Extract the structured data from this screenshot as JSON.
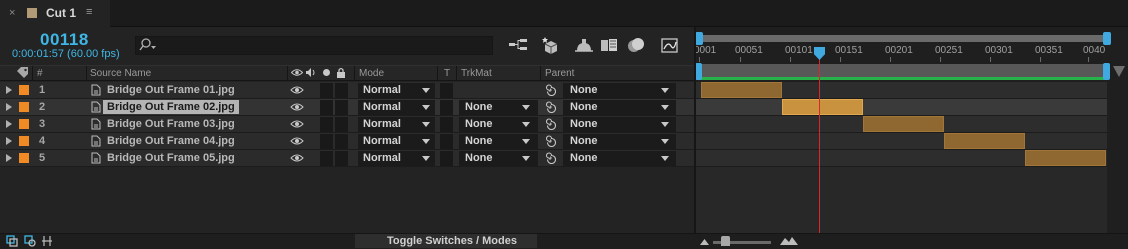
{
  "tab": {
    "close": "×",
    "title": "Cut 1",
    "menu": "≡",
    "swatch_color": "#b29a76"
  },
  "header": {
    "timecode": "00118",
    "timecode_detail": "0:00:01:57 (60.00 fps)",
    "search_placeholder": ""
  },
  "icons": {
    "search": "search-icon",
    "comp_flowchart": "flowchart-icon",
    "draft_3d": "draft-3d-icon",
    "hide_shy": "shy-layers-icon",
    "frame_blending": "frame-blending-icon",
    "motion_blur": "motion-blur-icon",
    "graph_editor": "graph-editor-icon"
  },
  "ruler": {
    "labels": [
      "0001",
      "00051",
      "00101",
      "00151",
      "00201",
      "00251",
      "00301",
      "00351",
      "0040"
    ],
    "current_frame": 118,
    "start": 1,
    "end": 401
  },
  "columns": {
    "hash": "#",
    "source_name": "Source Name",
    "mode": "Mode",
    "t": "T",
    "trkmat": "TrkMat",
    "parent": "Parent"
  },
  "layers": [
    {
      "num": "1",
      "name": "Bridge Out Frame 01.jpg",
      "mode": "Normal",
      "trkmat": "",
      "parent": "None",
      "in": 1,
      "out": 81,
      "selected": false
    },
    {
      "num": "2",
      "name": "Bridge Out Frame 02.jpg",
      "mode": "Normal",
      "trkmat": "None",
      "parent": "None",
      "in": 81,
      "out": 161,
      "selected": true
    },
    {
      "num": "3",
      "name": "Bridge Out Frame 03.jpg",
      "mode": "Normal",
      "trkmat": "None",
      "parent": "None",
      "in": 161,
      "out": 241,
      "selected": false
    },
    {
      "num": "4",
      "name": "Bridge Out Frame 04.jpg",
      "mode": "Normal",
      "trkmat": "None",
      "parent": "None",
      "in": 241,
      "out": 321,
      "selected": false
    },
    {
      "num": "5",
      "name": "Bridge Out Frame 05.jpg",
      "mode": "Normal",
      "trkmat": "None",
      "parent": "None",
      "in": 321,
      "out": 401,
      "selected": false
    }
  ],
  "colors": {
    "accent": "#3fb7e6",
    "label": "#f08a24",
    "clip": "#8f6831",
    "clip_selected": "#c9923e",
    "playhead": "#d62a2a",
    "work_area": "#27b34a"
  },
  "footer": {
    "toggle": "Toggle Switches / Modes",
    "zoom_level": 0.15
  }
}
